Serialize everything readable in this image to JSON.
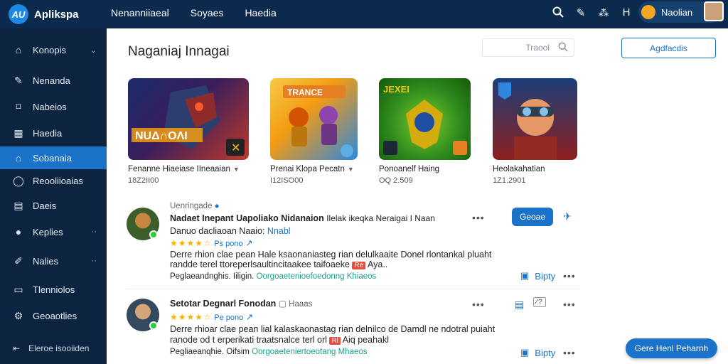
{
  "app": {
    "name": "Aplikspa",
    "logo_mark": "AU"
  },
  "topnav": [
    "Nenanniiaeal",
    "Soyaes",
    "Haedia"
  ],
  "top_icons": [
    "search-icon",
    "pin-icon",
    "translate-icon",
    "h-icon"
  ],
  "user": {
    "name": "Naolian"
  },
  "sidebar": {
    "items": [
      {
        "label": "Konopis",
        "icon": "home-icon",
        "chevron": "⌄"
      },
      {
        "label": "Nenanda",
        "icon": "edit-icon"
      },
      {
        "label": "Nabeios",
        "icon": "tag-icon"
      },
      {
        "label": "Haedia",
        "icon": "grid-icon"
      },
      {
        "label": "Sobanaia",
        "icon": "store-icon",
        "active": true
      },
      {
        "label": "Reooliioaias",
        "icon": "chat-icon"
      },
      {
        "label": "Daeis",
        "icon": "doc-icon"
      },
      {
        "label": "Keplies",
        "icon": "user-icon",
        "chevron": "··"
      },
      {
        "label": "Nalies",
        "icon": "pen-icon",
        "chevron": "··"
      },
      {
        "label": "Tlenniolos",
        "icon": "message-icon"
      },
      {
        "label": "Geoaotlies",
        "icon": "settings-icon"
      }
    ],
    "footer": "Eleroe isooiiden"
  },
  "main": {
    "title": "Naganiaj Innagai",
    "search_placeholder": "Traool",
    "primary_button": "Agdfacdis"
  },
  "cards": [
    {
      "name": "Fenanne Hiaeiase IIneaaian",
      "count": "18Z2II00",
      "has_chevron": true
    },
    {
      "name": "Prenai Klopa Pecatn",
      "count": "I12ISO00",
      "has_chevron": true
    },
    {
      "name": "Ponoanelf Haing",
      "count": "OQ 2.509",
      "has_chevron": false
    },
    {
      "name": "Heolakahatian",
      "count": "1Z1.2901",
      "has_chevron": false
    }
  ],
  "reviews": [
    {
      "header": "Uenringade",
      "title": "Nadaet Inepant Uapoliako Nidanaion",
      "title_suffix": "Ilelak ikeqka Neraigai I Naan",
      "subtitle": "Danuo dacliaoan Naaio:",
      "subtitle_link": "Nnabl",
      "stars": "★★★★☆",
      "sub_tag": "Ps pono",
      "body_line1": "Derre rhion clae pean Hale ksaonaniasteg rian delulkaaite Donel rlontankal pluaht",
      "body_line2": "randde terel ttoreperlsaultincitaakee taifoaeke",
      "body_tag": "Re",
      "body_line2_suffix": "Aya..",
      "footer_prefix": "Peglaeandnghis.",
      "footer_mid": "Iiligin.",
      "footer_link": "Oorgoaetenioefoedonng Khiaeos",
      "action_label": "Geoae",
      "reply_label": "Bipty"
    },
    {
      "title": "Setotar Degnarl Fonodan",
      "title_suffix": "Haaas",
      "stars": "★★★★☆",
      "sub_tag": "Pe pono",
      "body_line1": "Derre rhioar clae pean lial kalaskaonastag rian delnilco de Damdl ne ndotral puiaht",
      "body_line2": "ranode od t erperikati traatsnalce terl orl",
      "body_tag": "Rl",
      "body_line2_suffix": "Aiq peahakl",
      "footer_prefix": "Pegliaeanqhie.",
      "footer_mid": "Oifsim",
      "footer_link": "Oorgoaeteniertoeotang Mhaeos",
      "reply_label": "Bipty"
    }
  ],
  "chat_button": "Gere Henl Peharnh",
  "colors": {
    "topbar": "#0b2a4e",
    "sidebar": "#0d2440",
    "accent": "#1a73c9",
    "star": "#f5b301"
  }
}
